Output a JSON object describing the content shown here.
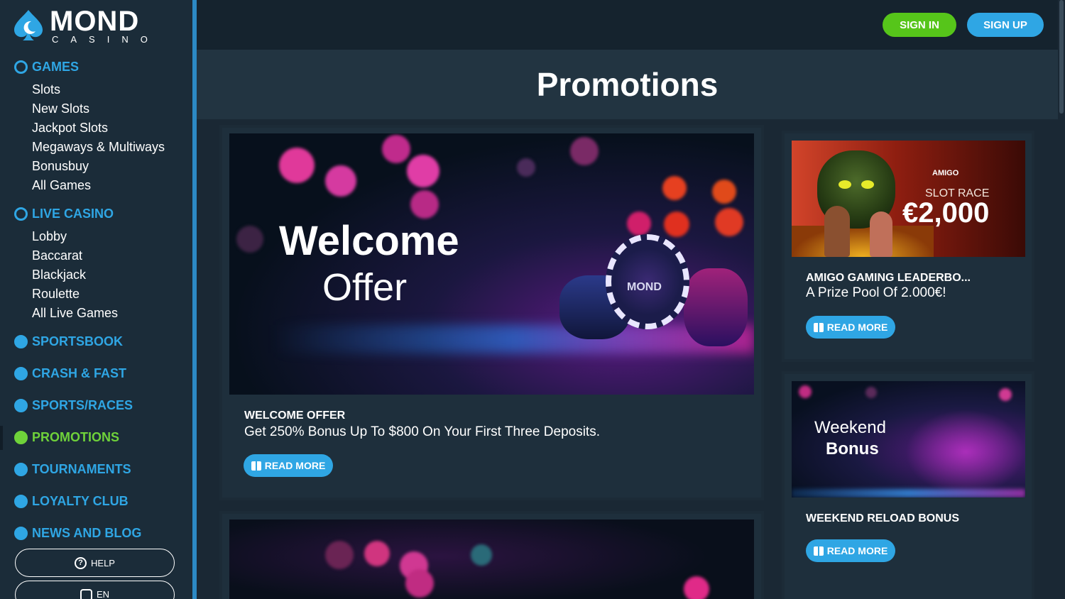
{
  "brand": {
    "name": "MOND",
    "subtitle": "CASINO"
  },
  "header": {
    "signin_label": "SIGN IN",
    "signup_label": "SIGN UP"
  },
  "page": {
    "title": "Promotions"
  },
  "sidebar": {
    "games": {
      "label": "GAMES",
      "items": [
        "Slots",
        "New Slots",
        "Jackpot Slots",
        "Megaways & Multiways",
        "Bonusbuy",
        "All Games"
      ]
    },
    "live_casino": {
      "label": "LIVE CASINO",
      "items": [
        "Lobby",
        "Baccarat",
        "Blackjack",
        "Roulette",
        "All Live Games"
      ]
    },
    "sportsbook": "SPORTSBOOK",
    "crash_fast": "CRASH & FAST",
    "sports_races": "SPORTS/RACES",
    "promotions": "PROMOTIONS",
    "tournaments": "TOURNAMENTS",
    "loyalty_club": "LOYALTY CLUB",
    "news_blog": "NEWS AND BLOG",
    "help_label": "HELP",
    "language_label": "EN"
  },
  "promos": {
    "welcome": {
      "banner_line1": "Welcome",
      "banner_line2": "Offer",
      "chip_text": "MOND",
      "title": "WELCOME OFFER",
      "description": "Get 250% Bonus Up To $800 On Your First Three Deposits.",
      "button": "READ MORE"
    },
    "amigo": {
      "banner_brand": "AMIGO",
      "banner_race": "SLOT RACE",
      "banner_prize": "€2,000",
      "title": "AMIGO GAMING LEADERBO...",
      "description": "A Prize Pool Of 2.000€!",
      "button": "READ MORE"
    },
    "weekend": {
      "banner_line1": "Weekend",
      "banner_line2": "Bonus",
      "title": "WEEKEND RELOAD BONUS",
      "button": "READ MORE"
    }
  },
  "colors": {
    "accent_blue": "#2fa6e4",
    "accent_green": "#56c51a",
    "bg_dark": "#1a2834",
    "sidebar_bg": "#1b2c39"
  }
}
